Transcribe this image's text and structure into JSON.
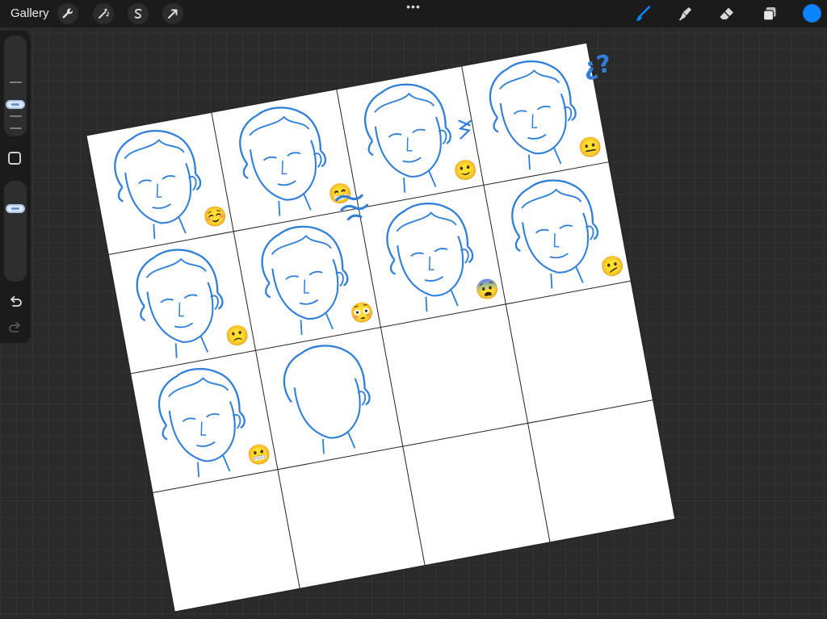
{
  "app": {
    "gallery_label": "Gallery",
    "accent_color": "#0a84ff"
  },
  "toolbar": {
    "left_tools": [
      "wrench-icon",
      "magic-wand-icon",
      "selection-icon",
      "transform-arrow-icon"
    ],
    "more_label": "•••",
    "right_tools": [
      "brush-icon",
      "smudge-icon",
      "eraser-icon",
      "layers-icon"
    ],
    "current_color": "#0a84ff"
  },
  "sidebar": {
    "brush_size_slider": "upper",
    "opacity_slider": "upper",
    "buttons": [
      "modify-square-button",
      "undo-arrow-icon",
      "redo-arrow-icon"
    ]
  },
  "canvas": {
    "grid_columns": 4,
    "grid_rows": 4,
    "line_color": "#2f7fd8",
    "expression_emojis": [
      "☺️",
      "😁",
      "🙂",
      "😐",
      "🙁",
      "😳",
      "😨",
      "🫤",
      "😬"
    ],
    "annotation_text": "¿?"
  }
}
